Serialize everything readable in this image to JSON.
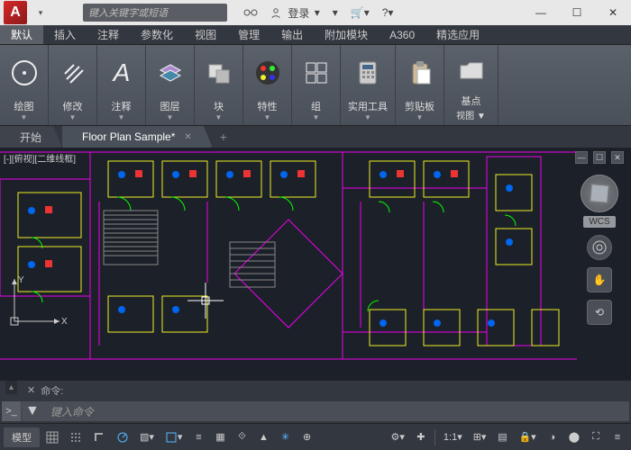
{
  "app": {
    "logo": "A"
  },
  "search": {
    "placeholder": "键入关键字或短语"
  },
  "title_icons": {
    "login": "登录"
  },
  "win": {
    "min": "—",
    "max": "☐",
    "close": "✕"
  },
  "ribbon_tabs": [
    "默认",
    "插入",
    "注释",
    "参数化",
    "视图",
    "管理",
    "输出",
    "附加模块",
    "A360",
    "精选应用"
  ],
  "panels": [
    {
      "label": "绘图",
      "icon": "circle"
    },
    {
      "label": "修改",
      "icon": "tools"
    },
    {
      "label": "注释",
      "icon": "letter"
    },
    {
      "label": "图层",
      "icon": "layers"
    },
    {
      "label": "块",
      "icon": "block"
    },
    {
      "label": "特性",
      "icon": "palette"
    },
    {
      "label": "组",
      "icon": "group"
    },
    {
      "label": "实用工具",
      "icon": "calc"
    },
    {
      "label": "剪贴板",
      "icon": "clip"
    },
    {
      "label": "基点",
      "icon": "folder",
      "extra": "视图 ▼"
    }
  ],
  "doc_tabs": [
    {
      "label": "开始",
      "active": false,
      "closable": false
    },
    {
      "label": "Floor Plan Sample*",
      "active": true,
      "closable": true
    }
  ],
  "viewport": {
    "label": "[-][俯视][二维线框]",
    "wcs": "WCS",
    "axes": {
      "x": "X",
      "y": "Y"
    }
  },
  "cmd": {
    "history_label": "命令:",
    "history_prefix": "✕",
    "placeholder": "键入命令",
    "icon": ">_"
  },
  "status": {
    "model": "模型",
    "scale": "1:1",
    "buttons": [
      "grid",
      "snap",
      "ortho",
      "polar",
      "osnap",
      "osnap3d",
      "dyn",
      "lwt",
      "trans",
      "cycle",
      "3d",
      "gizmo",
      "anno",
      "ws",
      "monitor",
      "iso",
      "hw",
      "clean"
    ]
  },
  "chart_data": null
}
